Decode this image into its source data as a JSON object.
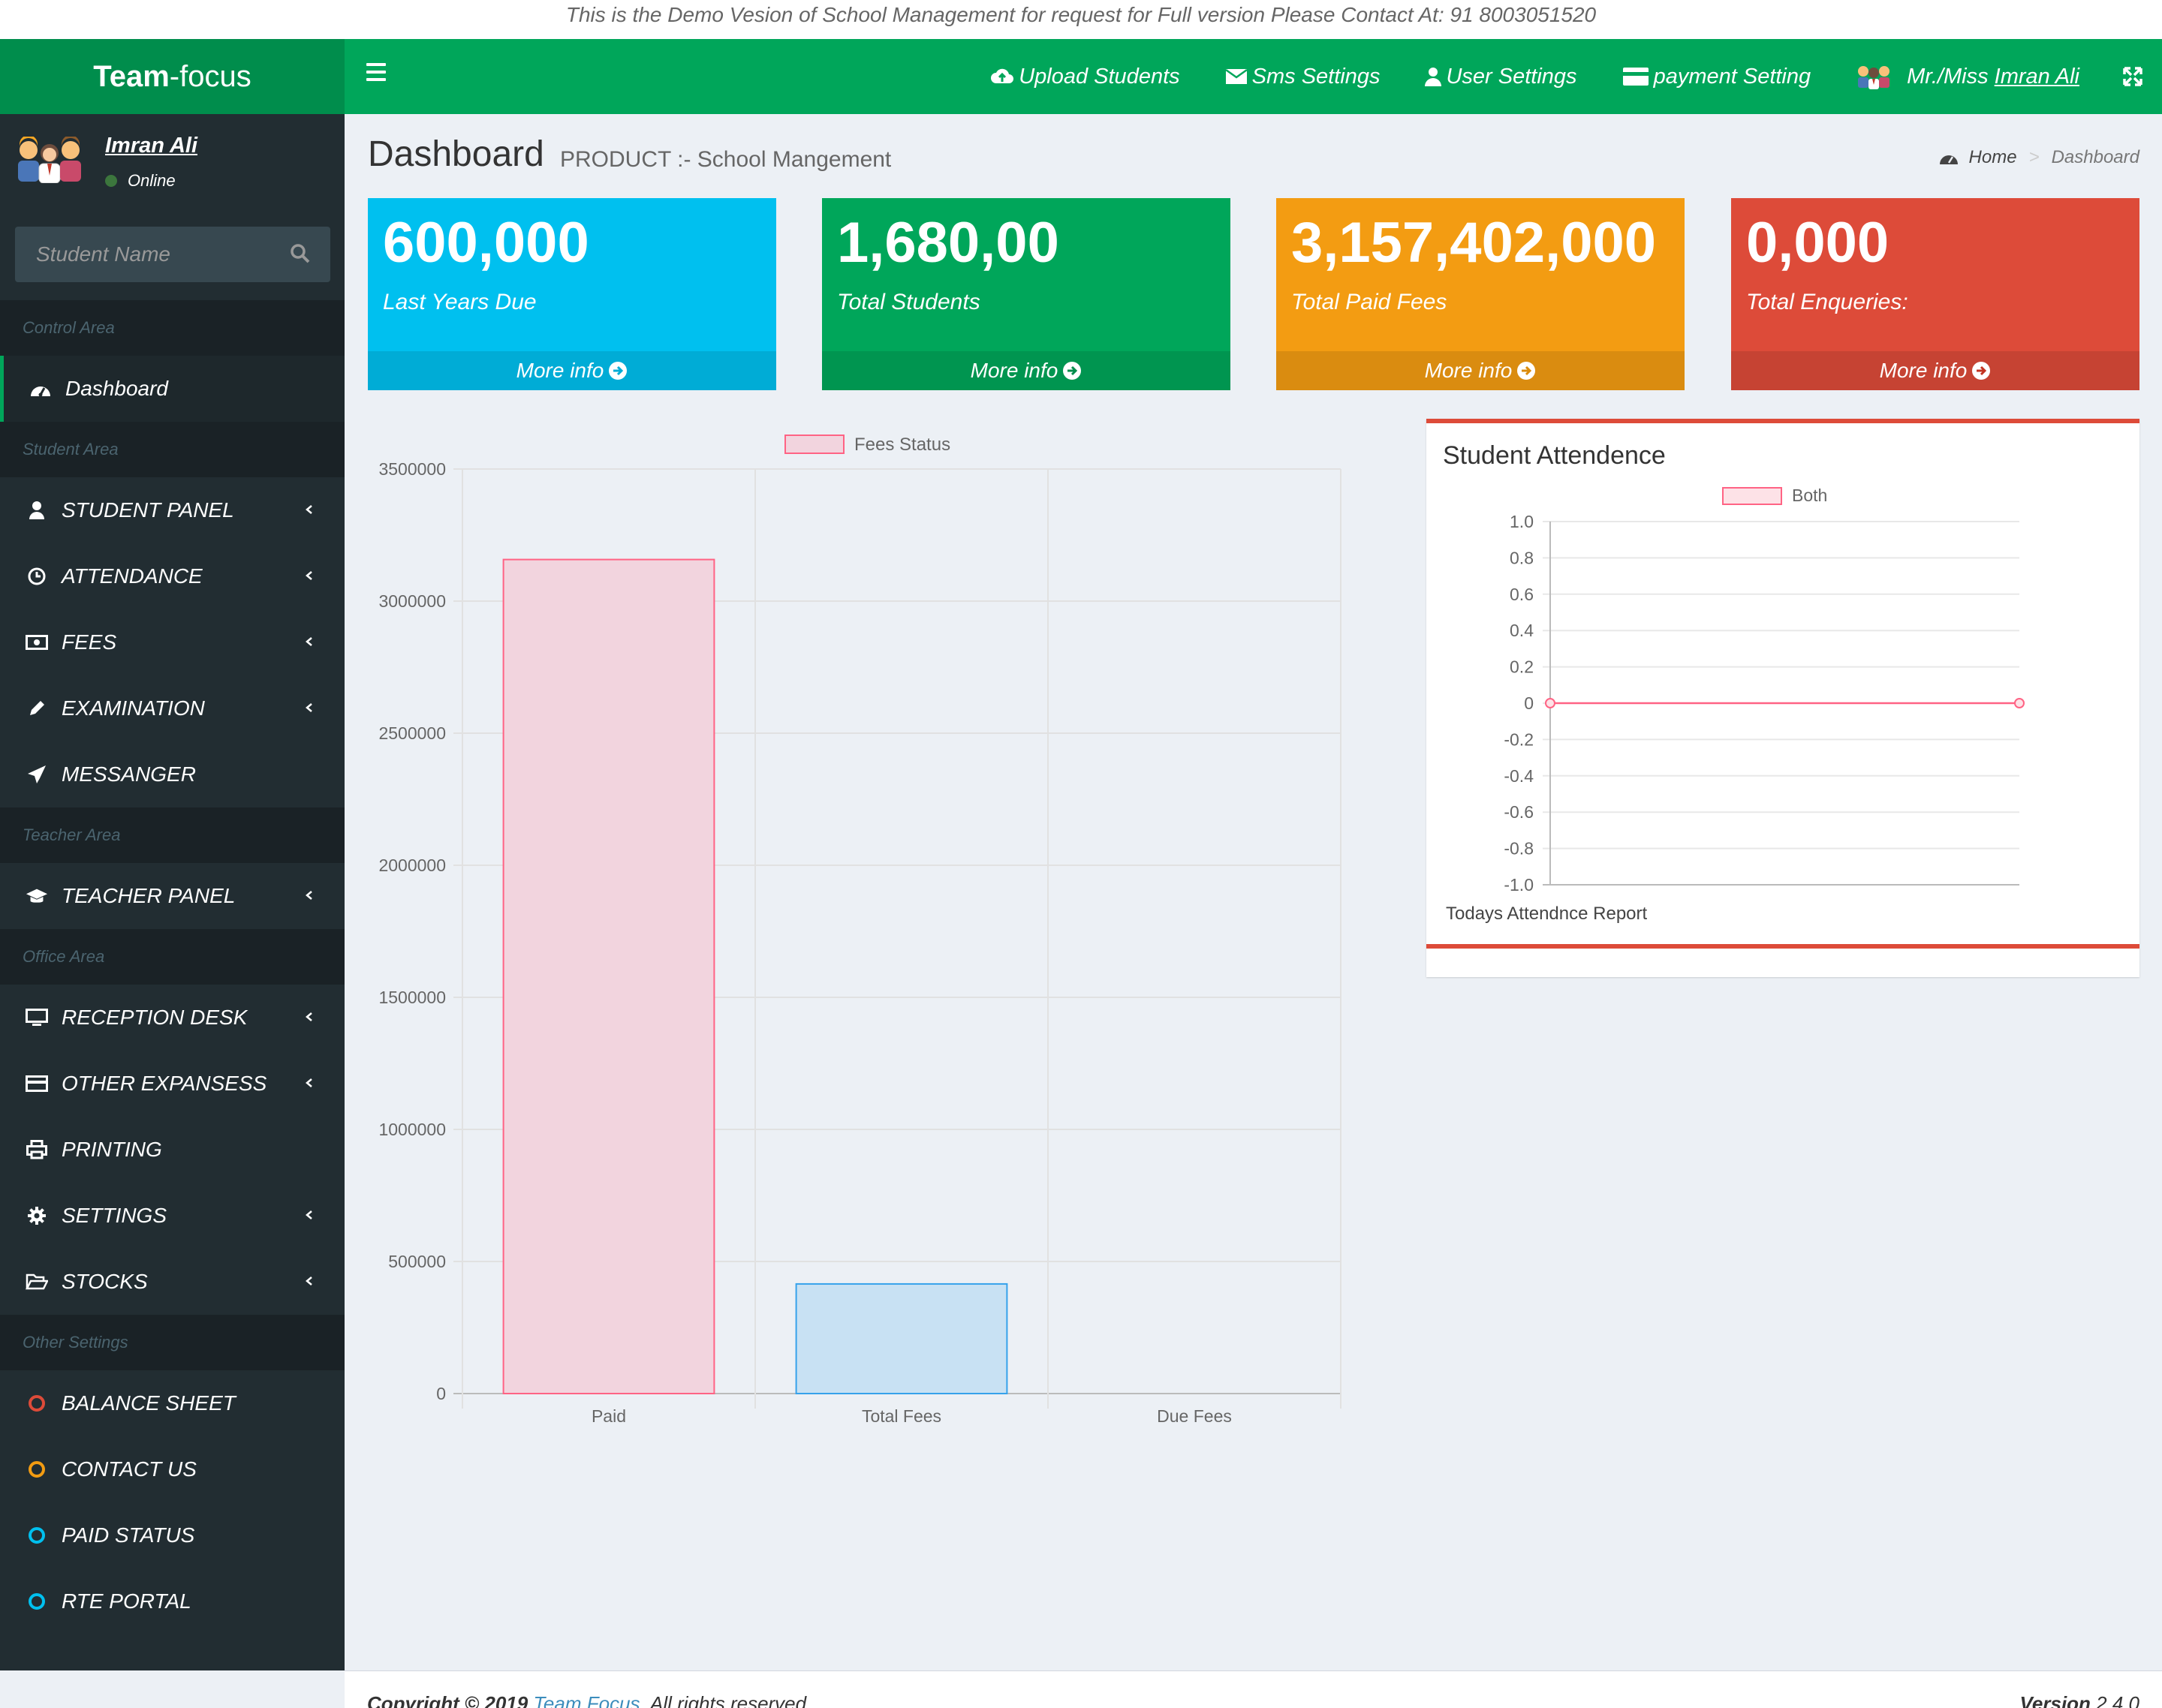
{
  "demo_banner": "This is the Demo Vesion of School Management for request for Full version Please Contact At: 91 8003051520",
  "brand": {
    "bold": "Team",
    "rest": "-focus"
  },
  "topnav": {
    "upload": "Upload Students",
    "sms": "Sms Settings",
    "user_settings": "User Settings",
    "payment": "payment Setting",
    "user_prefix": "Mr./Miss ",
    "user_name": "Imran Ali"
  },
  "sidebar": {
    "user_name": "Imran Ali",
    "status": "Online",
    "search_placeholder": "Student Name",
    "headers": {
      "control": "Control Area",
      "student": "Student Area",
      "teacher": "Teacher Area",
      "office": "Office Area",
      "other": "Other Settings"
    },
    "items": {
      "dashboard": "Dashboard",
      "student_panel": "STUDENT PANEL",
      "attendance": "ATTENDANCE",
      "fees": "FEES",
      "examination": "EXAMINATION",
      "messanger": "MESSANGER",
      "teacher_panel": "TEACHER PANEL",
      "reception": "RECEPTION DESK",
      "expanses": "OTHER EXPANSESS",
      "printing": "PRINTING",
      "settings": "SETTINGS",
      "stocks": "STOCKS",
      "balance": "BALANCE SHEET",
      "contact": "CONTACT US",
      "paid": "PAID STATUS",
      "rte": "RTE PORTAL"
    }
  },
  "page": {
    "title": "Dashboard",
    "subtitle": "PRODUCT :- School Mangement",
    "breadcrumb_home": "Home",
    "breadcrumb_current": "Dashboard"
  },
  "boxes": [
    {
      "value": "600,000",
      "label": "Last Years Due",
      "more": "More info",
      "color": "#00c0ef"
    },
    {
      "value": "1,680,00",
      "label": "Total Students",
      "more": "More info",
      "color": "#00a65a"
    },
    {
      "value": "3,157,402,000",
      "label": "Total Paid Fees",
      "more": "More info",
      "color": "#f39c12"
    },
    {
      "value": "0,000",
      "label": "Total Enqueries:",
      "more": "More info",
      "color": "#dd4b39"
    }
  ],
  "attendance_panel": {
    "title": "Student Attendence"
  },
  "chart_data": [
    {
      "type": "bar",
      "legend": "Fees Status",
      "categories": [
        "Paid",
        "Total Fees",
        "Due Fees"
      ],
      "values": [
        3157402,
        415000,
        0
      ],
      "ylim": [
        0,
        3500000
      ],
      "yticks": [
        "3500000",
        "3000000",
        "2500000",
        "2000000",
        "1500000",
        "1000000",
        "500000",
        "0"
      ],
      "colors": [
        "#f2d4de",
        "#c8e1f3",
        "#f7e6c8"
      ],
      "border_colors": [
        "#ff6384",
        "#36a2eb",
        "#ffce56"
      ],
      "grid": true,
      "legend_position": "top"
    },
    {
      "type": "line",
      "legend": "Both",
      "x": [
        "",
        ""
      ],
      "values": [
        0,
        0
      ],
      "ylim": [
        -1.0,
        1.0
      ],
      "yticks": [
        "1.0",
        "0.8",
        "0.6",
        "0.4",
        "0.2",
        "0",
        "-0.2",
        "-0.4",
        "-0.6",
        "-0.8",
        "-1.0"
      ],
      "xlabel": "Todays Attendnce Report",
      "color": "#ff6384",
      "grid": true,
      "legend_position": "top"
    }
  ],
  "footer": {
    "copyright": "Copyright © 2019 ",
    "brand": "Team Focus",
    "rights": ". All rights reserved.",
    "version_label": "Version",
    "version": " 2.4.0"
  }
}
